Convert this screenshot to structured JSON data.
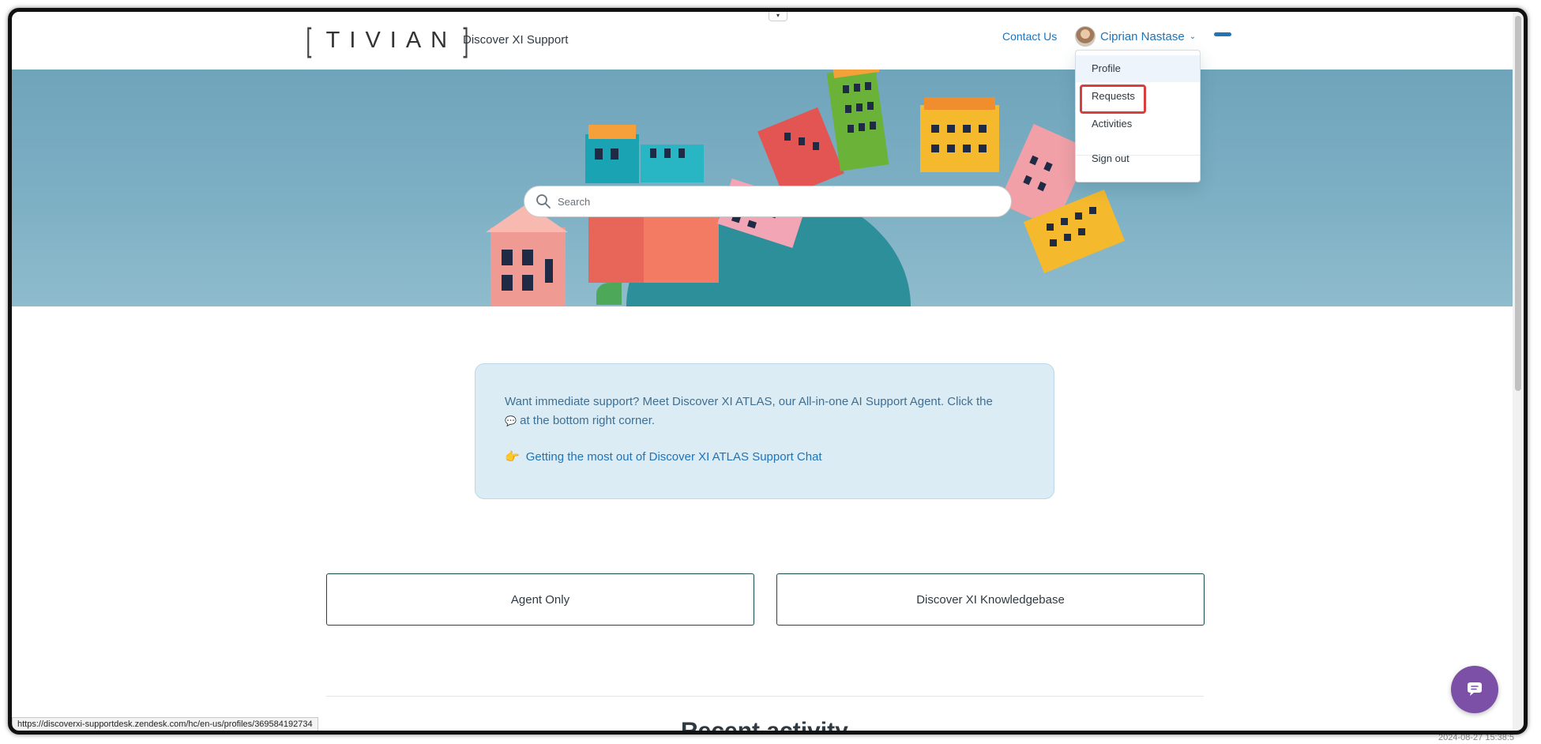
{
  "header": {
    "logo_text": "TIVIAN",
    "site_title": "Discover XI Support",
    "contact_label": "Contact Us",
    "user_name": "Ciprian Nastase"
  },
  "user_menu": {
    "items": [
      {
        "label": "Profile"
      },
      {
        "label": "Requests"
      },
      {
        "label": "Activities"
      },
      {
        "label": "Sign out"
      }
    ]
  },
  "search": {
    "placeholder": "Search"
  },
  "notice": {
    "text": "Want immediate support? Meet Discover XI ATLAS, our All-in-one AI Support Agent. Click the",
    "text2": "at the bottom right corner.",
    "link_emoji": "👉",
    "link_label": "Getting the most out of Discover XI ATLAS Support Chat"
  },
  "blocks": [
    {
      "label": "Agent Only"
    },
    {
      "label": "Discover XI Knowledgebase"
    }
  ],
  "recent_activity_title": "Recent activity",
  "status_url": "https://discoverxi-supportdesk.zendesk.com/hc/en-us/profiles/369584192734",
  "timestamp": "2024-08-27 15:38:5",
  "colors": {
    "accent": "#1f73b7",
    "highlight": "#d93f3c",
    "chat": "#7b50a6",
    "notice_bg": "#dcecf5"
  }
}
